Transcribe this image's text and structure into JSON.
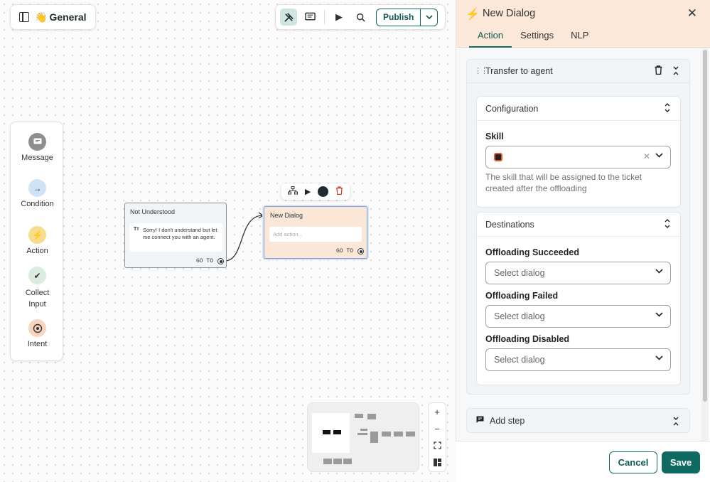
{
  "canvas": {
    "flow_title": "General",
    "flow_emoji": "👋",
    "toolbar": {
      "publish_label": "Publish"
    },
    "palette": [
      {
        "label": "Message",
        "icon": "message-icon",
        "color": "#8e8e8e"
      },
      {
        "label": "Condition",
        "icon": "arrow-right-icon",
        "color": "#cfe3f7"
      },
      {
        "label": "Action",
        "icon": "lightning-icon",
        "color": "#f7dd8b"
      },
      {
        "label": "Collect Input",
        "icon": "check-double-icon",
        "color": "#dcebe0"
      },
      {
        "label": "Intent",
        "icon": "target-icon",
        "color": "#f6d4bd"
      }
    ],
    "nodes": {
      "not_understood": {
        "title": "Not Understood",
        "message": "Sorry! I don't understand but let me connect you with an agent.",
        "goto": "GO TO"
      },
      "new_dialog": {
        "title": "New Dialog",
        "placeholder": "Add action...",
        "goto": "GO TO"
      }
    }
  },
  "panel": {
    "title": "New Dialog",
    "tabs": [
      "Action",
      "Settings",
      "NLP"
    ],
    "active_tab": "Action",
    "step": {
      "title": "Transfer to agent",
      "configuration": {
        "title": "Configuration",
        "skill_label": "Skill",
        "skill_help": "The skill that will be assigned to the ticket created after the offloading"
      },
      "destinations": {
        "title": "Destinations",
        "fields": [
          {
            "label": "Offloading Succeeded",
            "placeholder": "Select dialog"
          },
          {
            "label": "Offloading Failed",
            "placeholder": "Select dialog"
          },
          {
            "label": "Offloading Disabled",
            "placeholder": "Select dialog"
          }
        ]
      }
    },
    "add_step_label": "Add step",
    "cancel_label": "Cancel",
    "save_label": "Save"
  },
  "colors": {
    "accent": "#0f6b62",
    "header_bg": "#fbe8d9",
    "node_active_bg": "#fbe7d8"
  }
}
